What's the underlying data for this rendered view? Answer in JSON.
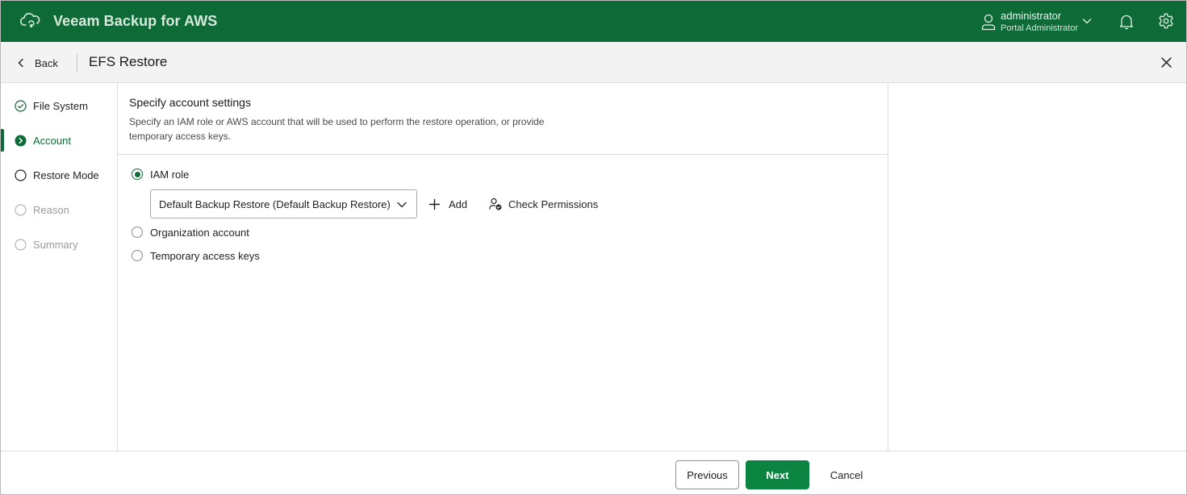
{
  "header": {
    "app_title": "Veeam Backup for AWS",
    "user_name": "administrator",
    "user_role": "Portal Administrator",
    "brand_color": "#0e6b37"
  },
  "titlebar": {
    "back_label": "Back",
    "title": "EFS Restore"
  },
  "steps": [
    {
      "label": "File System",
      "state": "completed"
    },
    {
      "label": "Account",
      "state": "current"
    },
    {
      "label": "Restore Mode",
      "state": "pending"
    },
    {
      "label": "Reason",
      "state": "disabled"
    },
    {
      "label": "Summary",
      "state": "disabled"
    }
  ],
  "main": {
    "section_title": "Specify account settings",
    "section_desc": "Specify an IAM role or AWS account that will be used to perform the restore operation, or provide temporary access keys.",
    "options": [
      {
        "label": "IAM role",
        "checked": true
      },
      {
        "label": "Organization account",
        "checked": false
      },
      {
        "label": "Temporary access keys",
        "checked": false
      }
    ],
    "iam_role_select": {
      "value": "Default Backup Restore (Default Backup Restore)"
    },
    "add_label": "Add",
    "check_permissions_label": "Check Permissions"
  },
  "footer": {
    "previous_label": "Previous",
    "next_label": "Next",
    "cancel_label": "Cancel"
  }
}
